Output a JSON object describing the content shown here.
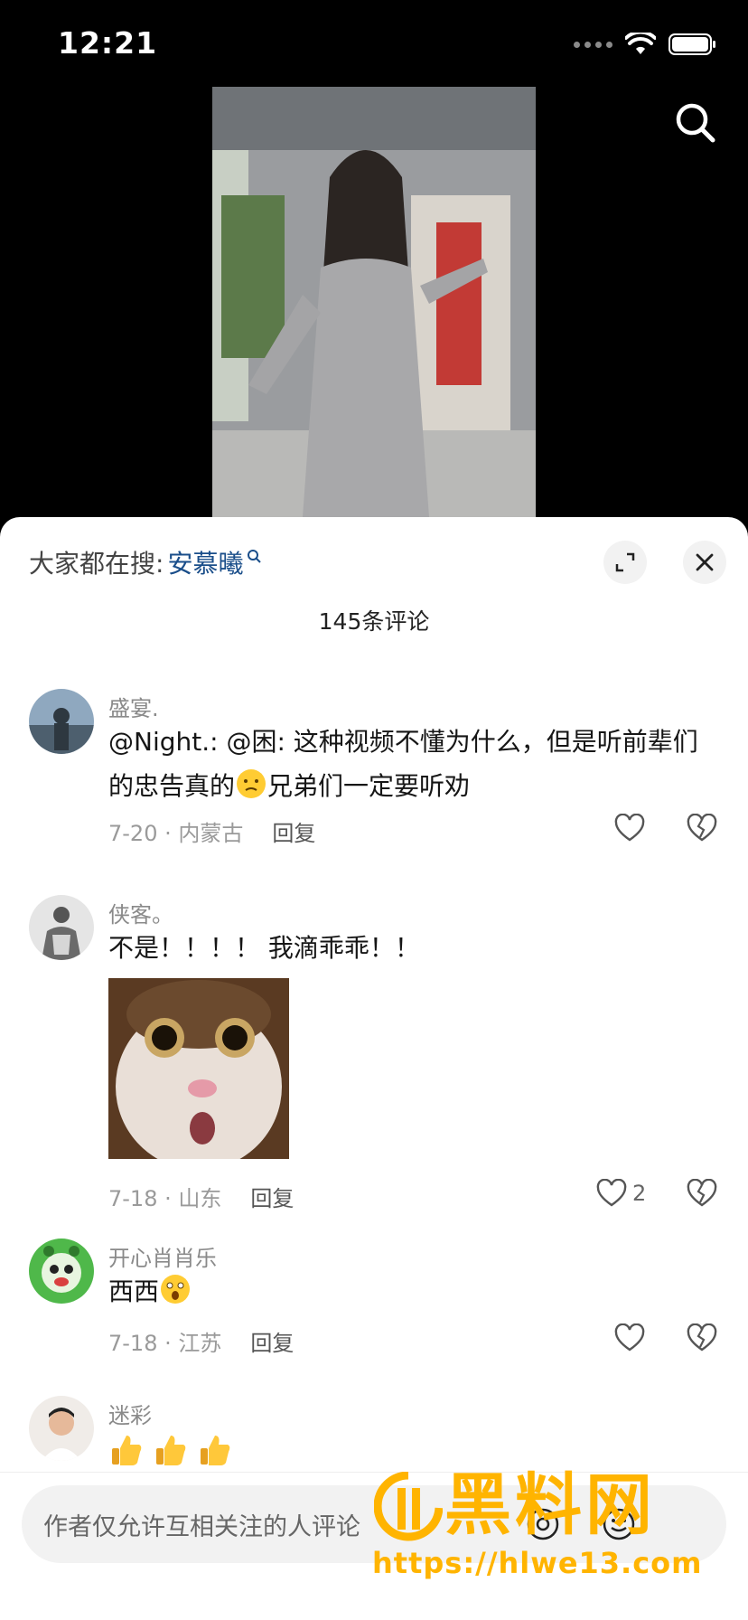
{
  "status_bar": {
    "time": "12:21"
  },
  "sheet": {
    "hot_search_prefix": "大家都在搜:",
    "hot_search_term": "安慕曦",
    "comment_count": "145条评论"
  },
  "comments": [
    {
      "username": "盛宴.",
      "text_line1": "@Night.: @困: 这种视频不懂为什么，但是听前辈们",
      "text_line2_a": "的忠告真的",
      "text_line2_b": "兄弟们一定要听劝",
      "date_location": "7-20 · 内蒙古",
      "reply": "回复",
      "likes": ""
    },
    {
      "username": "侠客。",
      "text": "不是！！！！ 我滴乖乖！！",
      "date_location": "7-18 · 山东",
      "reply": "回复",
      "likes": "2"
    },
    {
      "username": "开心肖肖乐",
      "text": "西西",
      "date_location": "7-18 · 江苏",
      "reply": "回复",
      "likes": ""
    },
    {
      "username": "迷彩"
    }
  ],
  "input": {
    "placeholder": "作者仅允许互相关注的人评论"
  },
  "watermark": {
    "brand": "黑料网",
    "url": "https://hlwe13.com"
  },
  "colors": {
    "sheet_bg": "#ffffff",
    "link_blue": "#1a4e8a",
    "watermark": "#ffb400"
  },
  "icons": [
    "search-icon",
    "expand-icon",
    "close-icon",
    "heart-icon",
    "broken-heart-icon",
    "at-icon",
    "emoji-icon"
  ]
}
